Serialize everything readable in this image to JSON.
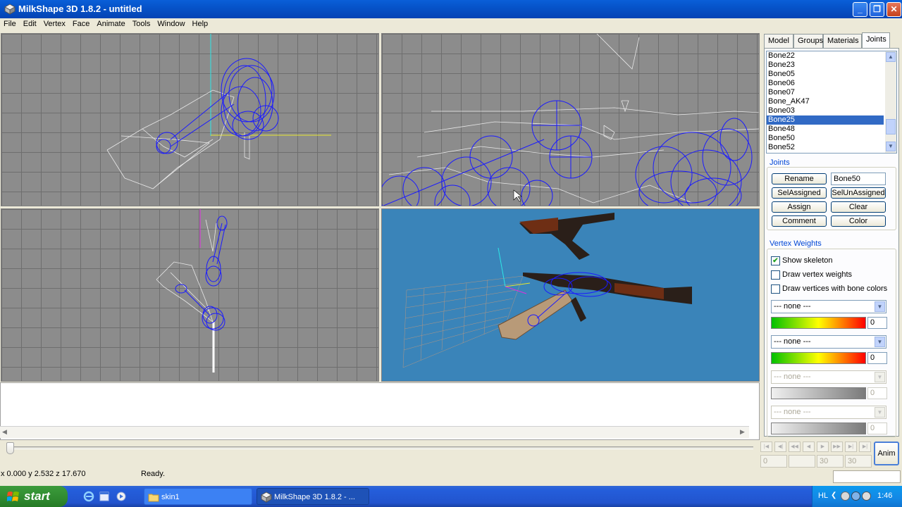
{
  "window": {
    "title": "MilkShape 3D 1.8.2 - untitled",
    "minimize": "_",
    "maximize": "❐",
    "close": "✕"
  },
  "menu": [
    "File",
    "Edit",
    "Vertex",
    "Face",
    "Animate",
    "Tools",
    "Window",
    "Help"
  ],
  "tabs": [
    "Model",
    "Groups",
    "Materials",
    "Joints"
  ],
  "bones": {
    "items": [
      "Bone22",
      "Bone23",
      "Bone05",
      "Bone06",
      "Bone07",
      "Bone_AK47",
      "Bone03",
      "Bone25",
      "Bone48",
      "Bone50",
      "Bone52"
    ],
    "selected": "Bone25"
  },
  "joints_group": {
    "label": "Joints",
    "rename": "Rename",
    "name_value": "Bone50",
    "sel_assigned": "SelAssigned",
    "sel_unassigned": "SelUnAssigned",
    "assign": "Assign",
    "clear": "Clear",
    "comment": "Comment",
    "color": "Color"
  },
  "vertex_weights": {
    "label": "Vertex Weights",
    "show_skeleton": {
      "label": "Show skeleton",
      "checked": true
    },
    "draw_vertex_weights": {
      "label": "Draw vertex weights",
      "checked": false
    },
    "draw_vertices_bone_colors": {
      "label": "Draw vertices with bone colors",
      "checked": false
    },
    "slots": [
      {
        "combo": "--- none ---",
        "value": "0",
        "enabled": true
      },
      {
        "combo": "--- none ---",
        "value": "0",
        "enabled": true
      },
      {
        "combo": "--- none ---",
        "value": "0",
        "enabled": false
      },
      {
        "combo": "--- none ---",
        "value": "0",
        "enabled": false
      }
    ]
  },
  "playback": {
    "buttons": [
      "|◀",
      "◀|",
      "◀◀",
      "◀",
      "▶",
      "▶▶",
      "▶|",
      "▶|"
    ],
    "frame_start": "0",
    "frame_current": "",
    "frame_end": "30",
    "frame_total": "30",
    "anim": "Anim"
  },
  "status": {
    "coords": "x 0.000 y 2.532 z 17.670",
    "message": "Ready."
  },
  "taskbar": {
    "start": "start",
    "tasks": [
      "skin1",
      "MilkShape 3D 1.8.2 - ..."
    ],
    "lang": "HL",
    "clock": "1:46"
  },
  "colors": {
    "selection": "#316ac5",
    "viewport_grid": "#8c8c8c",
    "viewport_3d": "#3a84b9",
    "bone_blue": "#1a1aff"
  }
}
